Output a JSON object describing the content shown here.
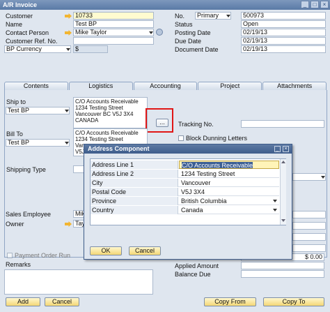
{
  "window": {
    "title": "A/R Invoice"
  },
  "header_left": {
    "customer": {
      "label": "Customer",
      "value": "10733"
    },
    "name": {
      "label": "Name",
      "value": "Test BP"
    },
    "contact_person": {
      "label": "Contact Person",
      "value": "Mike Taylor"
    },
    "customer_ref": {
      "label": "Customer Ref. No.",
      "value": ""
    },
    "currency": {
      "label": "BP Currency",
      "value": "$"
    }
  },
  "header_right": {
    "no": {
      "label": "No.",
      "series": "Primary",
      "value": "500973"
    },
    "status": {
      "label": "Status",
      "value": "Open"
    },
    "posting_date": {
      "label": "Posting Date",
      "value": "02/19/13"
    },
    "due_date": {
      "label": "Due Date",
      "value": "02/19/13"
    },
    "document_date": {
      "label": "Document Date",
      "value": "02/19/13"
    }
  },
  "tabs": [
    "Contents",
    "Logistics",
    "Accounting",
    "Project",
    "Attachments"
  ],
  "logistics": {
    "ship_to": {
      "label": "Ship to",
      "value": "Test BP",
      "address": [
        "C/O Accounts Receivable",
        "1234 Testing Street",
        "Vancouver BC V5J 3X4",
        "CANADA"
      ]
    },
    "bill_to": {
      "label": "Bill To",
      "value": "Test BP",
      "address": [
        "C/O Accounts Receivable",
        "1234 Testing Street",
        "Van",
        "V5J"
      ]
    },
    "browse_button": "...",
    "tracking_no": {
      "label": "Tracking No.",
      "value": ""
    },
    "block_dunning": {
      "label": "Block Dunning Letters"
    },
    "shipping_type": {
      "label": "Shipping Type"
    }
  },
  "footer_left": {
    "sales_employee": {
      "label": "Sales Employee",
      "value": "Mike"
    },
    "owner": {
      "label": "Owner",
      "value": "Tay"
    },
    "payment_order_run": {
      "label": "Payment Order Run"
    },
    "remarks": {
      "label": "Remarks"
    }
  },
  "footer_right": {
    "applied_amount": {
      "label": "Applied Amount",
      "value": ""
    },
    "balance_due": {
      "label": "Balance Due",
      "value": ""
    },
    "total_value": "$ 0.00"
  },
  "buttons": {
    "add": "Add",
    "cancel": "Cancel",
    "copy_from": "Copy From",
    "copy_to": "Copy To"
  },
  "dialog": {
    "title": "Address Component",
    "rows": [
      {
        "key": "Address Line 1",
        "value": "C/O Accounts Receivable"
      },
      {
        "key": "Address Line 2",
        "value": "1234 Testing Street"
      },
      {
        "key": "City",
        "value": "Vancouver"
      },
      {
        "key": "Postal Code",
        "value": "V5J 3X4"
      },
      {
        "key": "Province",
        "value": "British Columbia"
      },
      {
        "key": "Country",
        "value": "Canada"
      }
    ],
    "ok": "OK",
    "cancel": "Cancel"
  },
  "colors": {
    "accent": "#f3d675",
    "title_bar": "#5a7aa6",
    "highlight": "#e01616"
  }
}
